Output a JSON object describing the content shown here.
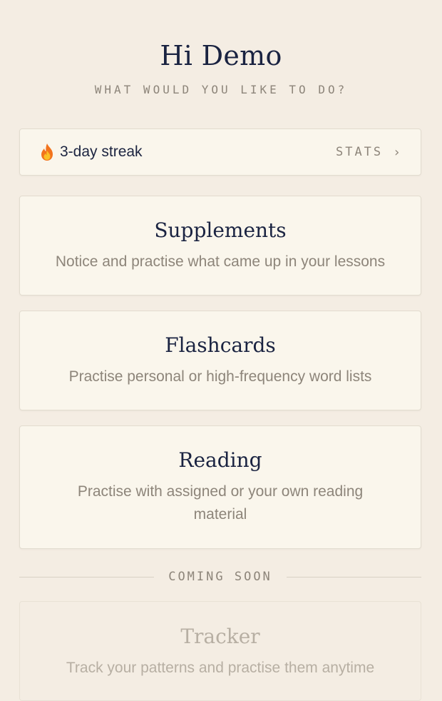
{
  "header": {
    "greeting": "Hi Demo",
    "subtitle": "WHAT WOULD YOU LIKE TO DO?"
  },
  "streak": {
    "icon": "fire-icon",
    "text": "3-day streak",
    "stats_label": "STATS",
    "chevron": "›"
  },
  "features": [
    {
      "title": "Supplements",
      "description": "Notice and practise what came up in your lessons"
    },
    {
      "title": "Flashcards",
      "description": "Practise personal or high-frequency word lists"
    },
    {
      "title": "Reading",
      "description": "Practise with assigned or your own reading material"
    }
  ],
  "coming_soon": {
    "label": "COMING SOON",
    "items": [
      {
        "title": "Tracker",
        "description": "Track your patterns and practise them anytime"
      }
    ]
  },
  "colors": {
    "background": "#f4ede3",
    "card": "#faf6ec",
    "heading": "#1a2341",
    "muted": "#8d857a",
    "disabled": "#b7afa3"
  }
}
